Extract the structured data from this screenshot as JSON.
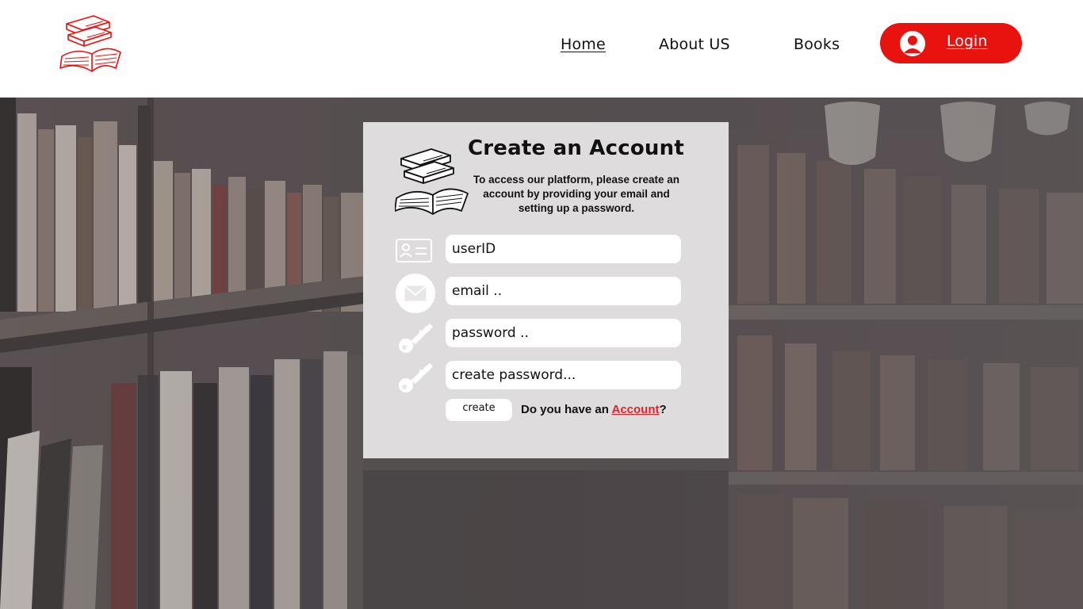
{
  "header": {
    "logo_icon": "books-stack-logo-icon",
    "nav": [
      {
        "label": "Home",
        "active": true
      },
      {
        "label": "About US"
      },
      {
        "label": "Books"
      }
    ],
    "login": {
      "label": "Login",
      "icon": "user-avatar-icon"
    }
  },
  "card": {
    "title": "Create an Account",
    "description": "To access our platform, please create an account by providing your email and setting up a password.",
    "fields": [
      {
        "icon": "id-card-icon",
        "placeholder": "userID"
      },
      {
        "icon": "envelope-icon",
        "placeholder": "email .."
      },
      {
        "icon": "key-icon",
        "placeholder": "password .."
      },
      {
        "icon": "key-icon",
        "placeholder": "create password..."
      }
    ],
    "create_label": "create",
    "account_prompt": "Do you have an ",
    "account_link": "Account",
    "account_suffix": "?"
  },
  "colors": {
    "accent": "#e8120f",
    "link": "#e0232a",
    "card_bg": "#e8e6e7",
    "text": "#111111"
  }
}
